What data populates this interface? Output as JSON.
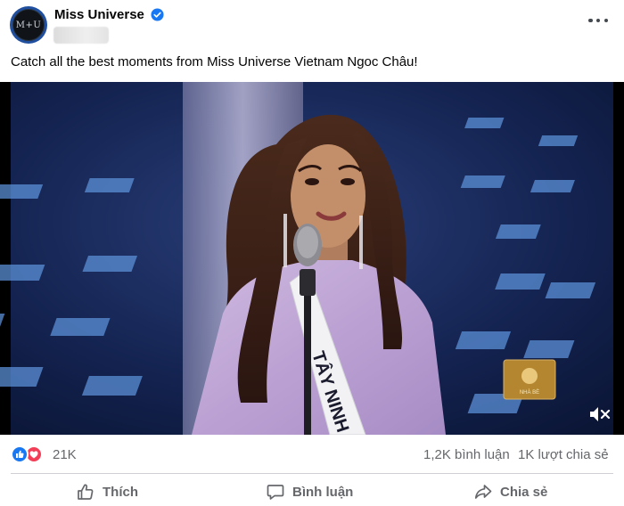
{
  "post": {
    "page_name": "Miss Universe",
    "avatar_text": "M+U",
    "caption": "Catch all the best moments from Miss Universe Vietnam Ngoc Châu!",
    "video": {
      "sash_text": "TÂY NINH",
      "logo_text": "NHÀ BÈ",
      "muted": true
    }
  },
  "stats": {
    "reactions_count": "21K",
    "comments": "1,2K bình luận",
    "shares": "1K lượt chia sẻ"
  },
  "actions": {
    "like": "Thích",
    "comment": "Bình luận",
    "share": "Chia sẻ"
  },
  "colors": {
    "brand_blue": "#1877f2",
    "love_red": "#f33e58",
    "muted_text": "#65676b"
  },
  "icons": [
    "verified-badge-icon",
    "more-options-icon",
    "muted-speaker-icon",
    "like-reaction-icon",
    "love-reaction-icon",
    "thumbs-up-icon",
    "comment-bubble-icon",
    "share-arrow-icon"
  ]
}
